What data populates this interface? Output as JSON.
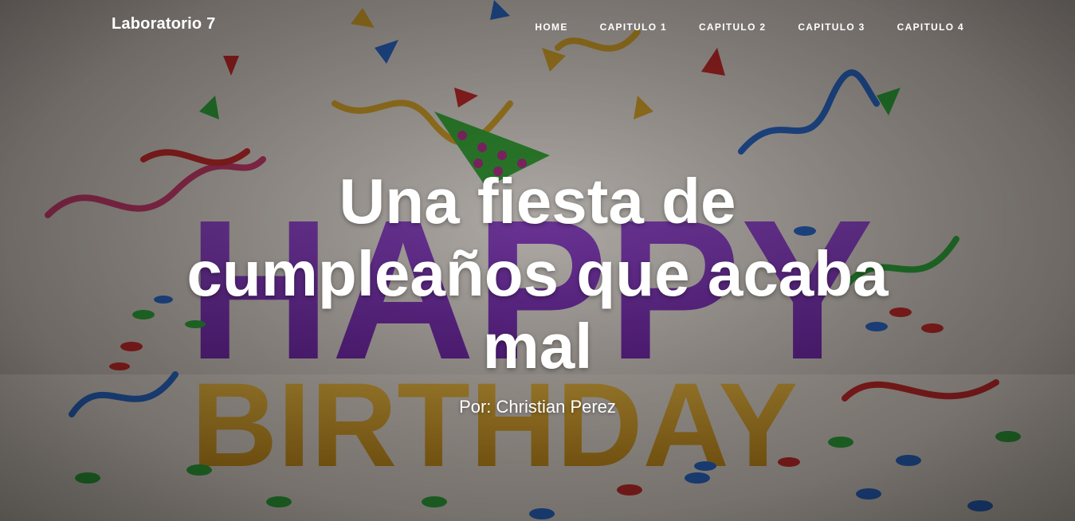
{
  "navbar": {
    "brand": "Laboratorio 7",
    "links": [
      {
        "label": "HOME"
      },
      {
        "label": "CAPITULO 1"
      },
      {
        "label": "CAPITULO 2"
      },
      {
        "label": "CAPITULO 3"
      },
      {
        "label": "CAPITULO 4"
      }
    ]
  },
  "hero": {
    "title": "Una fiesta de cumpleaños que acaba mal",
    "subtitle": "Por: Christian Perez",
    "background_image": "happy-birthday-illustration",
    "background_text": [
      "HAPPY",
      "BIRTHDAY"
    ],
    "colors": {
      "happy_letters": "#7a2fb0",
      "birthday_letters": "#d29a1e",
      "party_hat": "#3aa83a",
      "overlay": "#000000"
    }
  }
}
